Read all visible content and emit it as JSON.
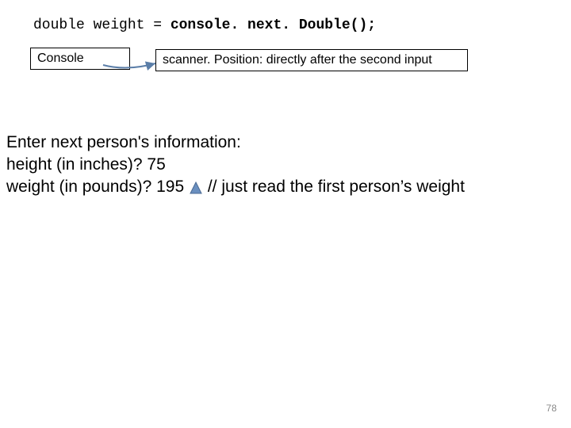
{
  "code": {
    "prefix": "double weight = ",
    "bold": "console. next. Double();"
  },
  "boxes": {
    "console": "Console",
    "scanner": "scanner. Position:  directly after the second input"
  },
  "body": {
    "line1": "Enter next person's information:",
    "line2": "height (in inches)?  75",
    "line3_prefix": "weight (in pounds)?  195 ",
    "line3_comment": "  // just read the first person’s weight"
  },
  "page_number": "78"
}
